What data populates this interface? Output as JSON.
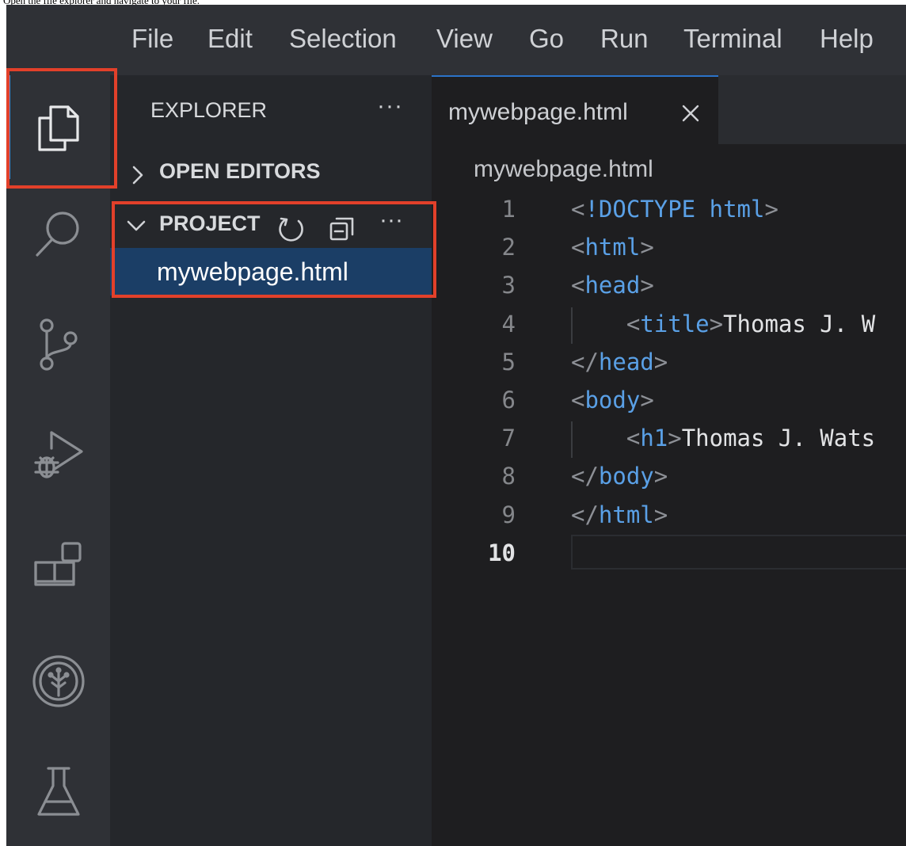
{
  "caption": "Open the file explorer and navigate to your file.",
  "menubar": {
    "items": [
      "File",
      "Edit",
      "Selection",
      "View",
      "Go",
      "Run",
      "Terminal",
      "Help"
    ]
  },
  "activity_bar": {
    "icons": [
      "explorer-icon",
      "search-icon",
      "source-control-icon",
      "run-debug-icon",
      "extensions-icon",
      "tree-icon",
      "testing-icon"
    ],
    "active": "explorer-icon"
  },
  "sidebar": {
    "title": "EXPLORER",
    "more_label": "···",
    "open_editors_label": "OPEN EDITORS",
    "project_label": "PROJECT",
    "project_more_label": "···",
    "files": [
      "mywebpage.html"
    ]
  },
  "editor": {
    "tab_label": "mywebpage.html",
    "breadcrumb": "mywebpage.html",
    "current_line": 10,
    "lines": [
      {
        "n": "1",
        "parts": [
          [
            "p",
            "<"
          ],
          [
            "kw",
            "!DOCTYPE"
          ],
          [
            "p",
            " "
          ],
          [
            "t",
            "html"
          ],
          [
            "p",
            ">"
          ]
        ]
      },
      {
        "n": "2",
        "parts": [
          [
            "p",
            "<"
          ],
          [
            "t",
            "html"
          ],
          [
            "p",
            ">"
          ]
        ]
      },
      {
        "n": "3",
        "parts": [
          [
            "p",
            "<"
          ],
          [
            "t",
            "head"
          ],
          [
            "p",
            ">"
          ]
        ]
      },
      {
        "n": "4",
        "parts": [
          [
            "p",
            "    <"
          ],
          [
            "t",
            "title"
          ],
          [
            "p",
            ">"
          ],
          [
            "x",
            "Thomas J. W"
          ]
        ]
      },
      {
        "n": "5",
        "parts": [
          [
            "p",
            "</"
          ],
          [
            "t",
            "head"
          ],
          [
            "p",
            ">"
          ]
        ]
      },
      {
        "n": "6",
        "parts": [
          [
            "p",
            "<"
          ],
          [
            "t",
            "body"
          ],
          [
            "p",
            ">"
          ]
        ]
      },
      {
        "n": "7",
        "parts": [
          [
            "p",
            "    <"
          ],
          [
            "t",
            "h1"
          ],
          [
            "p",
            ">"
          ],
          [
            "x",
            "Thomas J. Wats"
          ]
        ]
      },
      {
        "n": "8",
        "parts": [
          [
            "p",
            "</"
          ],
          [
            "t",
            "body"
          ],
          [
            "p",
            ">"
          ]
        ]
      },
      {
        "n": "9",
        "parts": [
          [
            "p",
            "</"
          ],
          [
            "t",
            "html"
          ],
          [
            "p",
            ">"
          ]
        ]
      },
      {
        "n": "10",
        "parts": []
      }
    ]
  },
  "colors": {
    "highlight": "#e2402a",
    "selection": "#1b3e66",
    "tag": "#5aa0e6",
    "active_indicator": "#3d8fe0"
  }
}
